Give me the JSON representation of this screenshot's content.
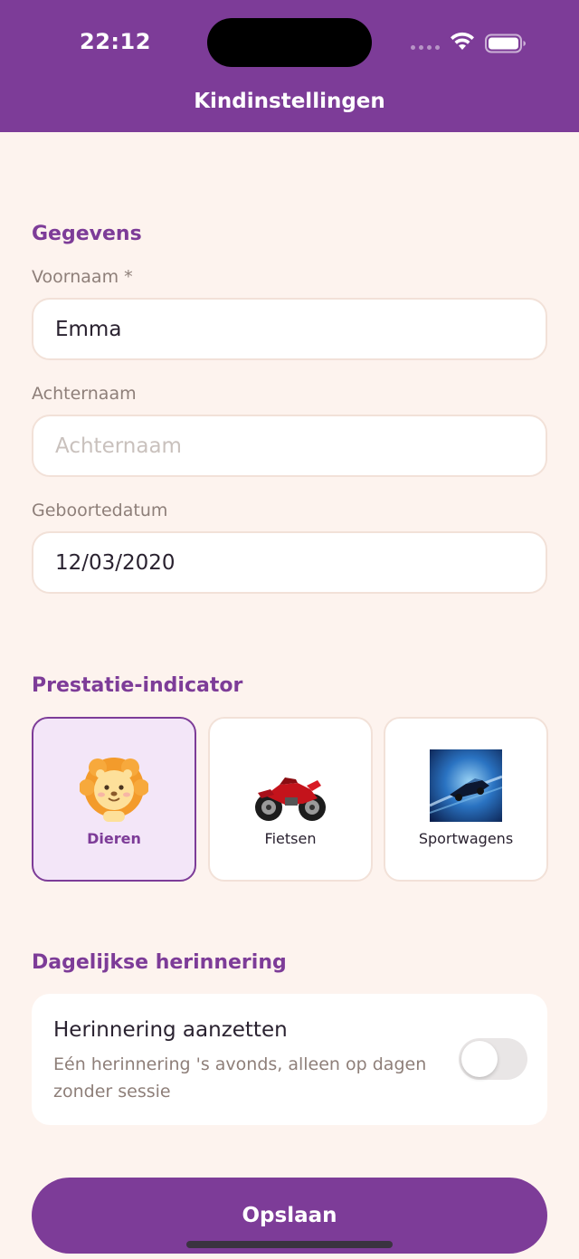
{
  "status_bar": {
    "time": "22:12",
    "icons": [
      "signal-dots-icon",
      "wifi-icon",
      "battery-icon"
    ]
  },
  "nav": {
    "title": "Kindinstellingen"
  },
  "details": {
    "section_title": "Gegevens",
    "first_name": {
      "label": "Voornaam *",
      "value": "Emma"
    },
    "last_name": {
      "label": "Achternaam",
      "value": "",
      "placeholder": "Achternaam"
    },
    "birth_date": {
      "label": "Geboortedatum",
      "value": "12/03/2020"
    }
  },
  "indicator": {
    "section_title": "Prestatie-indicator",
    "options": [
      {
        "label": "Dieren",
        "icon": "lion-icon",
        "selected": true
      },
      {
        "label": "Fietsen",
        "icon": "motorcycle-icon",
        "selected": false
      },
      {
        "label": "Sportwagens",
        "icon": "sportscar-icon",
        "selected": false
      }
    ]
  },
  "reminder": {
    "section_title": "Dagelijkse herinnering",
    "title": "Herinnering aanzetten",
    "description": "Eén herinnering 's avonds, alleen op dagen zonder sessie",
    "enabled": false
  },
  "save_label": "Opslaan",
  "colors": {
    "accent": "#7d3c98",
    "background": "#fdf3ee",
    "selected_card": "#f3e6f8",
    "muted_text": "#8e7f79"
  }
}
